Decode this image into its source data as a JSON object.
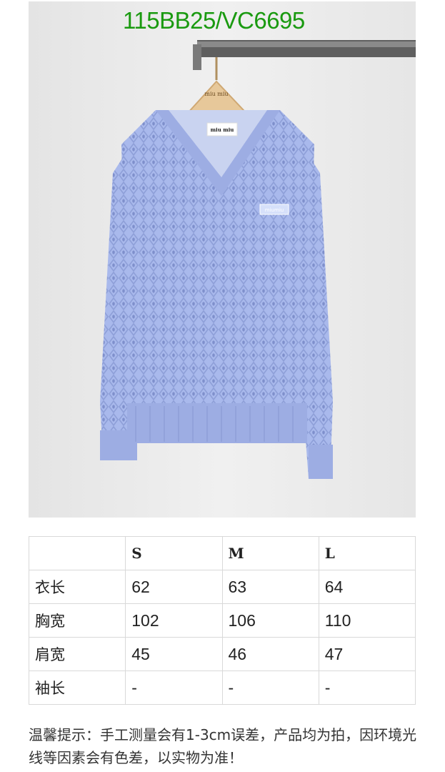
{
  "product_code": "115BB25/VC6695",
  "photo": {
    "hanger_brand": "miu miu",
    "neck_label": "miu miu",
    "chest_patch": "miumiu",
    "colors": {
      "sweater": "#a9b9ec",
      "background": "#ededed",
      "hanger": "#e7c89a",
      "code_text": "#1a9a10"
    }
  },
  "size_table": {
    "headers": [
      "",
      "S",
      "M",
      "L"
    ],
    "rows": [
      {
        "label": "衣长",
        "values": [
          "62",
          "63",
          "64"
        ]
      },
      {
        "label": "胸宽",
        "values": [
          "102",
          "106",
          "110"
        ]
      },
      {
        "label": "肩宽",
        "values": [
          "45",
          "46",
          "47"
        ]
      },
      {
        "label": "袖长",
        "values": [
          "-",
          "-",
          "-"
        ]
      }
    ]
  },
  "note": "温馨提示：手工测量会有1-3cm误差，产品均为拍，因环境光线等因素会有色差，以实物为准！"
}
